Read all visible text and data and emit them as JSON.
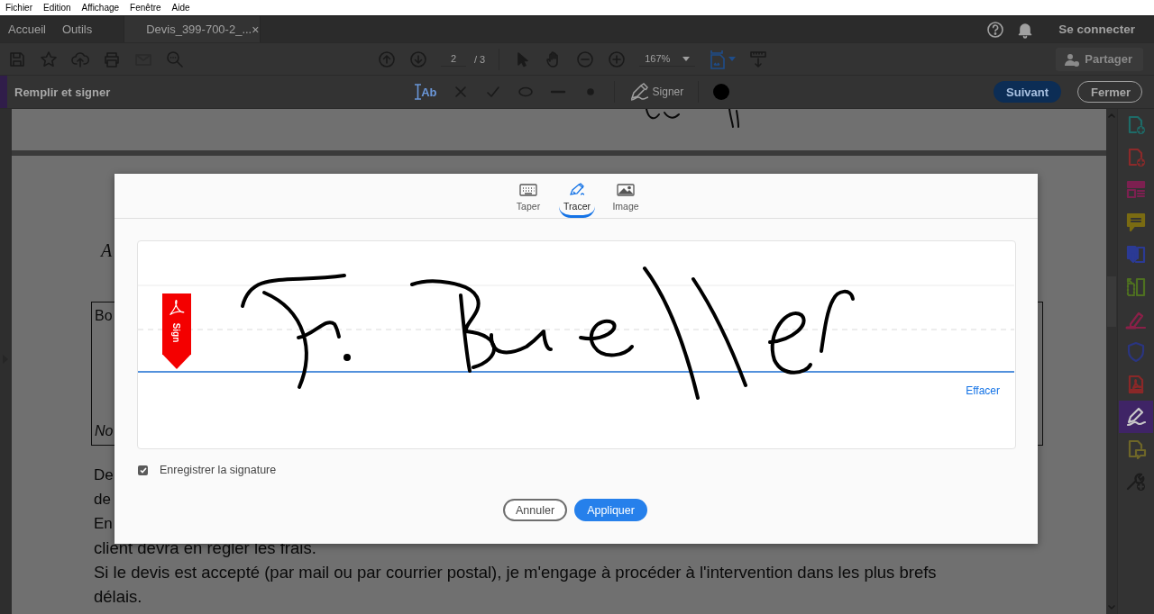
{
  "menu_bar": [
    "Fichier",
    "Edition",
    "Affichage",
    "Fenêtre",
    "Aide"
  ],
  "tabs": [
    {
      "label": "Accueil",
      "selected": false
    },
    {
      "label": "Outils",
      "selected": false
    },
    {
      "label": "Devis_399-700-2_...",
      "selected": true,
      "close": "×"
    }
  ],
  "account": {
    "sign_in": "Se connecter"
  },
  "toolbar": {
    "page_current": "2",
    "page_total": "/ 3",
    "zoom": "167%",
    "share": {
      "label": "Partager",
      "disabled": true
    }
  },
  "fill_sign_bar": {
    "title": "Remplir et signer",
    "text_tool": "Ab",
    "sign": "Signer",
    "next": "Suivant",
    "close": "Fermer"
  },
  "document": {
    "heading_fragment": "A",
    "box": {
      "top_fragment": "Bo",
      "bottom_fragment": "No"
    },
    "paragraph_fragments": [
      "De",
      "de",
      "En"
    ],
    "paragraph_lines": [
      "client devra en régler les frais.",
      "Si le devis est  accepté (par mail ou par courrier postal), je m'engage à procéder à l'intervention dans les plus brefs",
      "délais."
    ]
  },
  "tools": [
    {
      "kind": "file-add",
      "color": "#1e6b68",
      "selected": false
    },
    {
      "kind": "file-add",
      "color": "#8c2a2a",
      "selected": false
    },
    {
      "kind": "layout",
      "color": "#7c2050",
      "selected": false
    },
    {
      "kind": "comment",
      "color": "#7a6b12",
      "selected": false
    },
    {
      "kind": "export",
      "color": "#2b3a94",
      "selected": false
    },
    {
      "kind": "split",
      "color": "#4e7020",
      "selected": false
    },
    {
      "kind": "highlight",
      "color": "#8a2048",
      "selected": false
    },
    {
      "kind": "shield",
      "color": "#2a3580",
      "selected": false
    },
    {
      "kind": "pdf",
      "color": "#8a2828",
      "selected": false
    },
    {
      "kind": "sign",
      "color": "#c8c8c8",
      "selected": true
    },
    {
      "kind": "file-comment",
      "color": "#6e6628",
      "selected": false
    },
    {
      "kind": "wrench-add",
      "color": "#1c1c1c",
      "selected": false
    }
  ],
  "dialog": {
    "tabs": [
      {
        "label": "Taper",
        "kind": "keyboard",
        "selected": false
      },
      {
        "label": "Tracer",
        "kind": "pen",
        "selected": true
      },
      {
        "label": "Image",
        "kind": "image",
        "selected": false
      }
    ],
    "badge": "Sign",
    "clear": "Effacer",
    "save": {
      "label": "Enregistrer la signature",
      "checked": true
    },
    "buttons": [
      {
        "label": "Annuler",
        "kind": "secondary"
      },
      {
        "label": "Appliquer",
        "kind": "primary"
      }
    ]
  }
}
